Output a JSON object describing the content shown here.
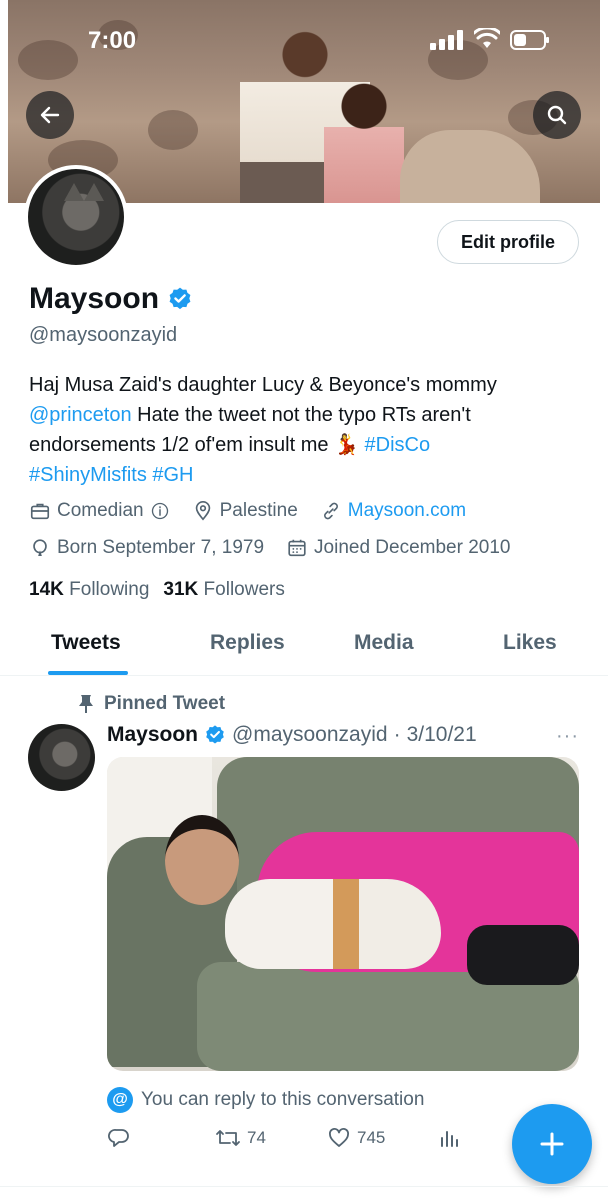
{
  "status_bar": {
    "time": "7:00"
  },
  "profile": {
    "name": "Maysoon",
    "handle": "@maysoonzayid",
    "edit_label": "Edit profile",
    "bio": {
      "part1": "Haj Musa Zaid's daughter Lucy & Beyonce's mommy ",
      "mention": "@princeton",
      "part2": " Hate the tweet not the typo RTs aren't endorsements 1/2 of'em insult me ",
      "emoji": "💃",
      "tag1": "#DisCo",
      "tag2": "#ShinyMisfits",
      "tag3": "#GH"
    },
    "category": "Comedian",
    "location": "Palestine",
    "website": "Maysoon.com",
    "born": "Born September 7, 1979",
    "joined": "Joined December 2010",
    "following_count": "14K",
    "following_label": "Following",
    "followers_count": "31K",
    "followers_label": "Followers"
  },
  "tabs": [
    "Tweets",
    "Replies",
    "Media",
    "Likes"
  ],
  "pinned_tweet": {
    "pinned_label": "Pinned Tweet",
    "author": "Maysoon",
    "handle": "@maysoonzayid",
    "date": "3/10/21",
    "more": "···",
    "reply_note": "You can reply to this conversation",
    "retweets": "74",
    "likes": "745"
  },
  "colors": {
    "accent": "#1d9bf0",
    "text": "#0f1419",
    "muted": "#536471"
  },
  "icons": [
    "back-arrow-icon",
    "search-icon",
    "verified-badge-icon",
    "briefcase-icon",
    "info-icon",
    "location-pin-icon",
    "link-icon",
    "balloon-icon",
    "calendar-icon",
    "pin-icon",
    "reply-icon",
    "retweet-icon",
    "heart-icon",
    "analytics-icon",
    "plus-icon"
  ]
}
